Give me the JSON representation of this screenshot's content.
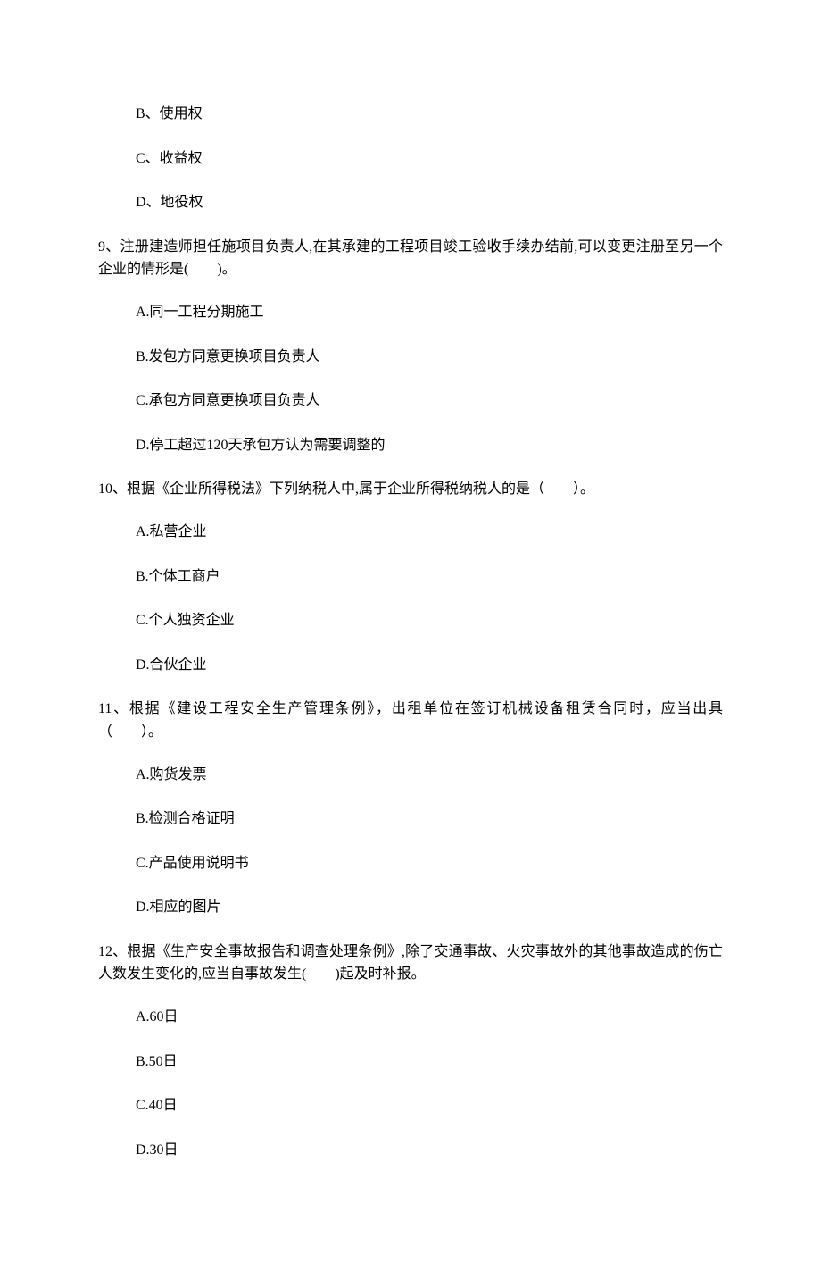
{
  "q8": {
    "optB": "B、使用权",
    "optC": "C、收益权",
    "optD": "D、地役权"
  },
  "q9": {
    "stem": "9、注册建造师担任施项目负责人,在其承建的工程项目竣工验收手续办结前,可以变更注册至另一个企业的情形是(　　)。",
    "optA": "A.同一工程分期施工",
    "optB": "B.发包方同意更换项目负责人",
    "optC": "C.承包方同意更换项目负责人",
    "optD": "D.停工超过120天承包方认为需要调整的"
  },
  "q10": {
    "stem": "10、根据《企业所得税法》下列纳税人中,属于企业所得税纳税人的是（　　）。",
    "optA": "A.私营企业",
    "optB": "B.个体工商户",
    "optC": "C.个人独资企业",
    "optD": "D.合伙企业"
  },
  "q11": {
    "stem": "11、根据《建设工程安全生产管理条例》，出租单位在签订机械设备租赁合同时，应当出具（　　）。",
    "optA": "A.购货发票",
    "optB": "B.检测合格证明",
    "optC": "C.产品使用说明书",
    "optD": "D.相应的图片"
  },
  "q12": {
    "stem": "12、根据《生产安全事故报告和调查处理条例》,除了交通事故、火灾事故外的其他事故造成的伤亡人数发生变化的,应当自事故发生(　　)起及时补报。",
    "optA": "A.60日",
    "optB": "B.50日",
    "optC": "C.40日",
    "optD": "D.30日"
  }
}
